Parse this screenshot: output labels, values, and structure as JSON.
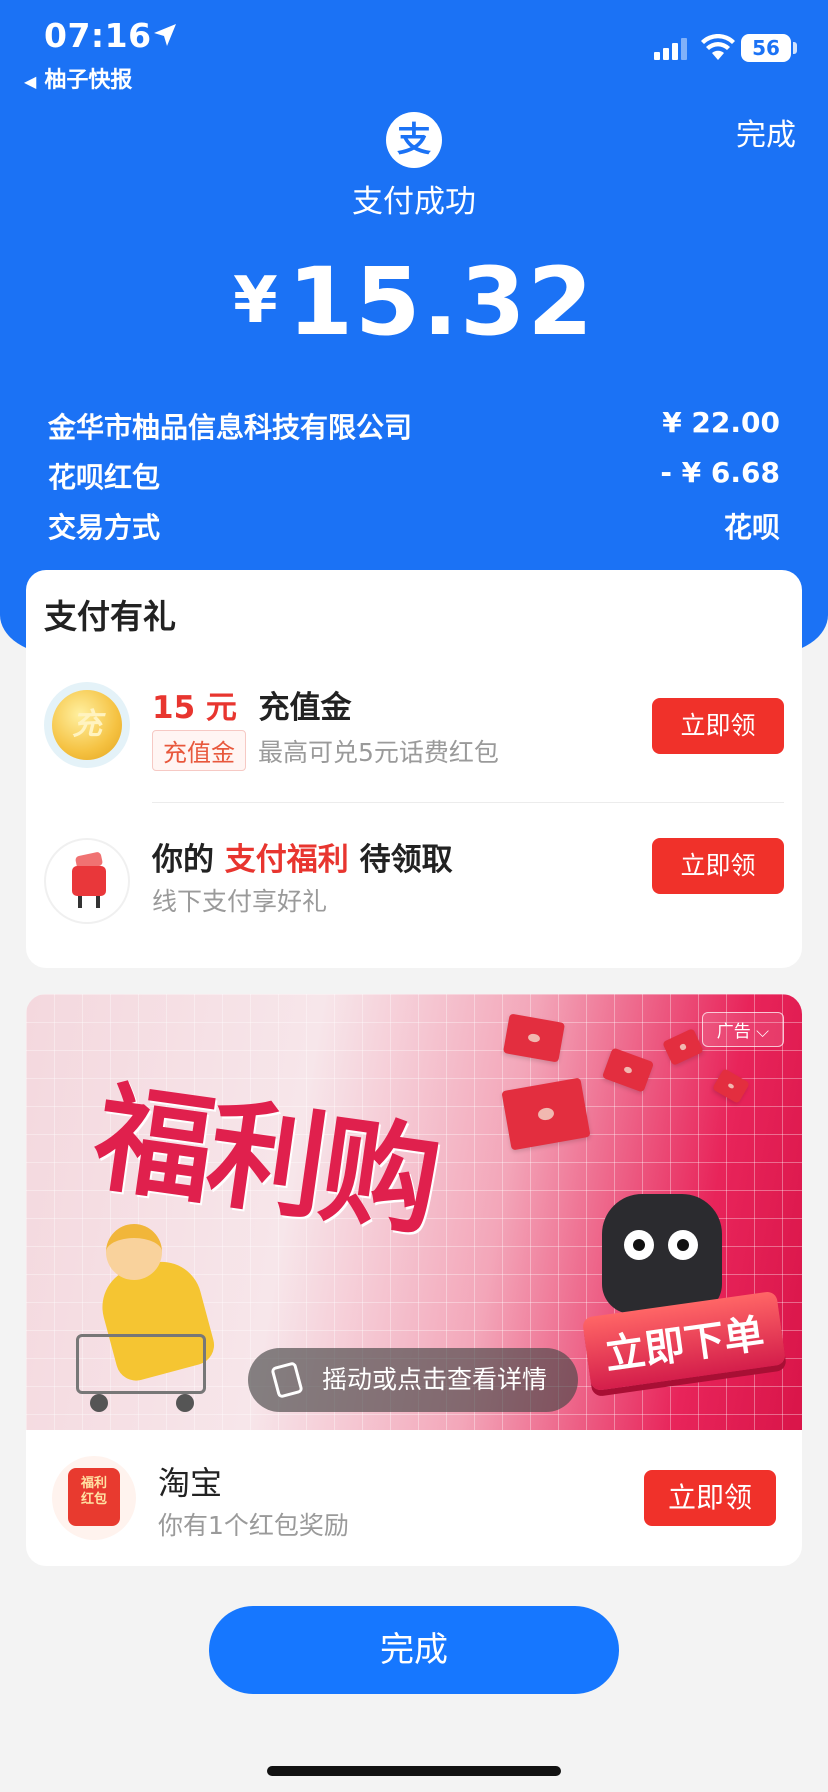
{
  "status_bar": {
    "time": "07:16",
    "back_app": "柚子快报",
    "battery": "56"
  },
  "header": {
    "done_label": "完成",
    "logo_char": "支",
    "title": "支付成功",
    "currency": "¥",
    "amount": "15.32"
  },
  "details": [
    {
      "label": "金华市柚品信息科技有限公司",
      "value": "¥ 22.00"
    },
    {
      "label": "花呗红包",
      "value": "- ¥ 6.68"
    },
    {
      "label": "交易方式",
      "value": "花呗"
    }
  ],
  "gifts": {
    "title": "支付有礼",
    "item1": {
      "coin_char": "充",
      "amount": "15 元",
      "name": "充值金",
      "tag": "充值金",
      "desc": "最高可兑5元话费红包",
      "button": "立即领"
    },
    "item2": {
      "prefix": "你的",
      "highlight": "支付福利",
      "suffix": "待领取",
      "desc": "线下支付享好礼",
      "button": "立即领"
    }
  },
  "banner": {
    "ad_label": "广告",
    "headline": "福利购",
    "cta": "立即下单",
    "shake_text": "摇动或点击查看详情"
  },
  "taobao": {
    "icon_text": "福利\n红包",
    "name": "淘宝",
    "desc": "你有1个红包奖励",
    "button": "立即领"
  },
  "footer": {
    "done_button": "完成"
  },
  "colors": {
    "brand_blue": "#1b72f5",
    "accent_red": "#f0312a",
    "button_blue": "#1677ff"
  }
}
